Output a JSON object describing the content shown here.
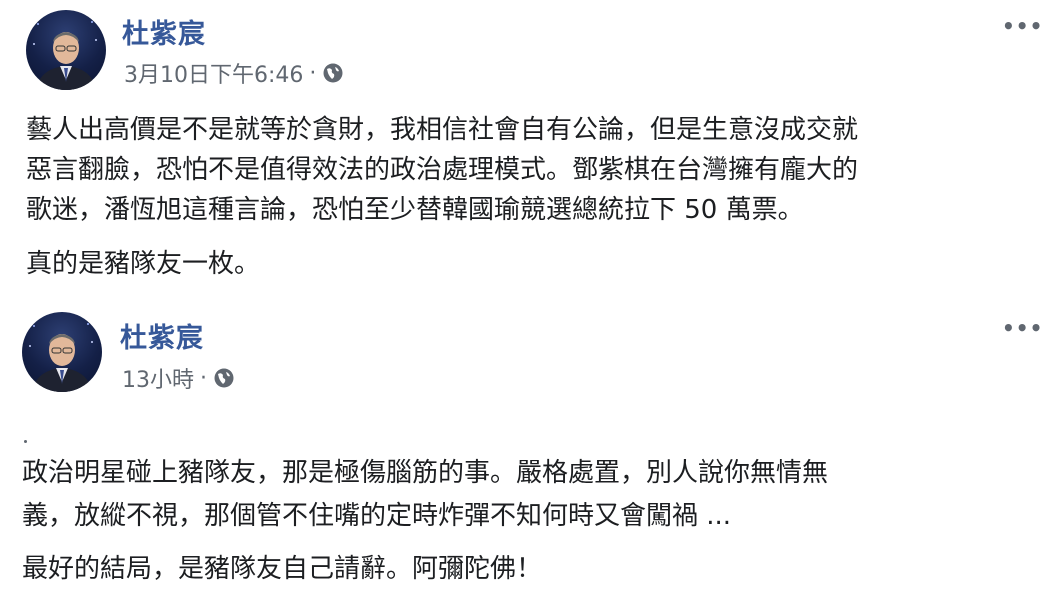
{
  "posts": [
    {
      "author": "杜紫宸",
      "time": "3月10日下午6:46",
      "separator": "·",
      "privacy_icon": "globe-icon",
      "more_icon": "more-options-icon",
      "more_label": "•••",
      "lines": [
        "藝人出高價是不是就等於貪財，我相信社會自有公論，但是生意沒成交就",
        "惡言翻臉，恐怕不是值得效法的政治處理模式。鄧紫棋在台灣擁有龐大的",
        "歌迷，潘恆旭這種言論，恐怕至少替韓國瑜競選總統拉下 50 萬票。"
      ],
      "closing": "真的是豬隊友一枚。"
    },
    {
      "author": "杜紫宸",
      "time": "13小時",
      "separator": "·",
      "privacy_icon": "globe-icon",
      "more_icon": "more-options-icon",
      "more_label": "•••",
      "lines": [
        "政治明星碰上豬隊友，那是極傷腦筋的事。嚴格處置，別人說你無情無",
        "義，放縱不視，那個管不住嘴的定時炸彈不知何時又會闖禍 ..."
      ],
      "closing": "最好的結局，是豬隊友自己請辭。阿彌陀佛！"
    }
  ],
  "colors": {
    "author_name": "#365899",
    "meta_text": "#606770",
    "body_text": "#1c1e21",
    "background": "#ffffff"
  }
}
